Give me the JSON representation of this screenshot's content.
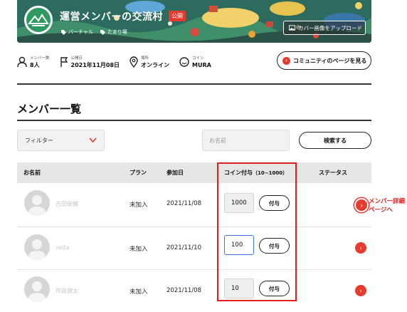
{
  "banner": {
    "title": "運営メンバーの交流村",
    "public_badge": "公開",
    "tags": [
      "バーチャル",
      "たまり場"
    ],
    "upload_button": "カバー画像をアップロード"
  },
  "stats": [
    {
      "label": "メンバー数",
      "value": "8人",
      "icon": "person-icon"
    },
    {
      "label": "公開日",
      "value": "2021年11月08日",
      "icon": "flag-icon"
    },
    {
      "label": "場所",
      "value": "オンライン",
      "icon": "location-pin-icon"
    },
    {
      "label": "コイン",
      "value": "MURA",
      "icon": "coin-icon"
    }
  ],
  "community_button": "コミュニティのページを見る",
  "section_title": "メンバー一覧",
  "filter": {
    "label": "フィルター"
  },
  "search": {
    "placeholder": "お名前",
    "button": "検索する"
  },
  "table": {
    "headers": {
      "name": "お名前",
      "plan": "プラン",
      "joined": "参加日",
      "coin": "コイン付与",
      "coin_range": "（10~1000）",
      "status": "ステータス"
    },
    "give_label": "付与",
    "rows": [
      {
        "name": "吉田俊輔",
        "plan": "未加入",
        "joined": "2021/11/08",
        "coin": "1000"
      },
      {
        "name": "seita",
        "plan": "未加入",
        "joined": "2021/11/10",
        "coin": "100"
      },
      {
        "name": "市坂健太",
        "plan": "未加入",
        "joined": "2021/11/08",
        "coin": "10"
      }
    ]
  },
  "annotation": {
    "line1": "メンバー詳細",
    "line2": "ページへ"
  },
  "colors": {
    "accent": "#e63a2f",
    "annotation": "#e02020",
    "focus": "#3b7bd8"
  }
}
